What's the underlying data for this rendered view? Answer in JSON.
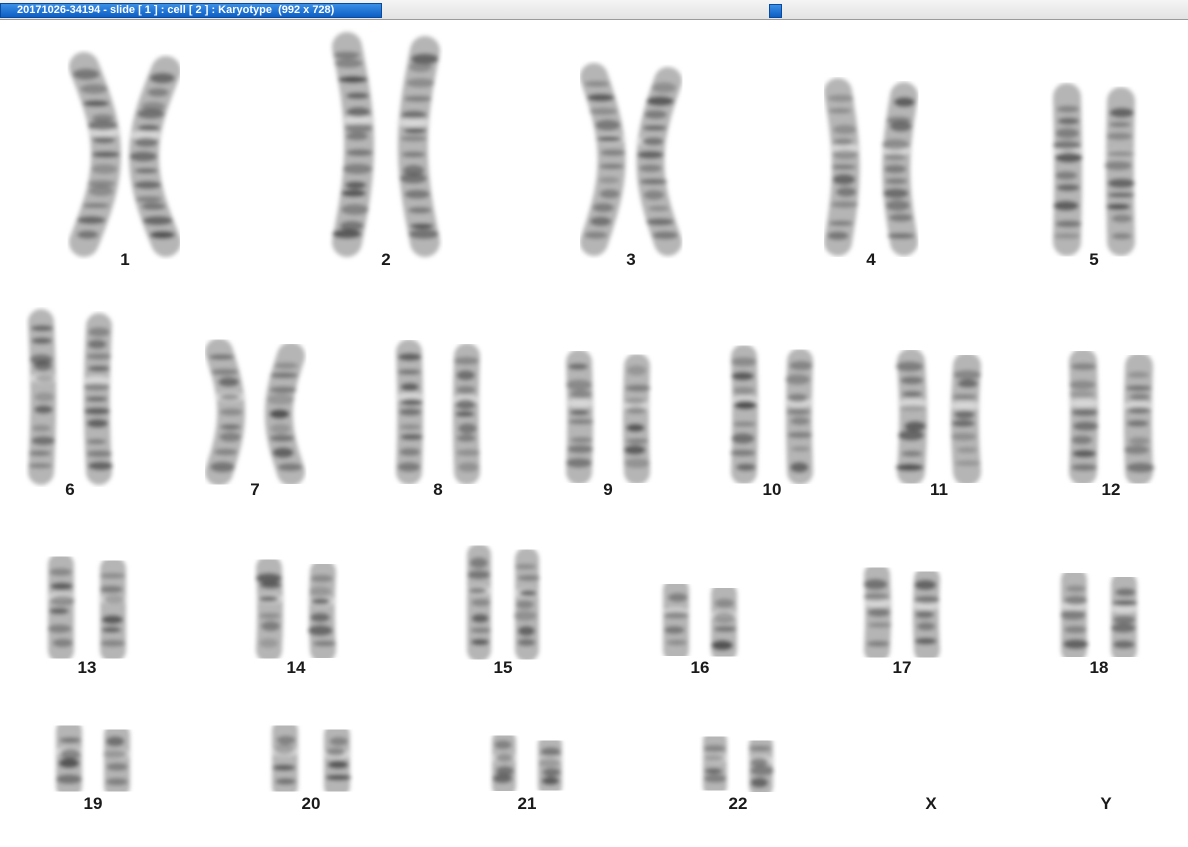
{
  "window": {
    "title": "20171026-34194 - slide [ 1 ] : cell [ 2 ] : Karyotype  (992 x 728)"
  },
  "karyotype": {
    "chromosomes": [
      {
        "label": "1"
      },
      {
        "label": "2"
      },
      {
        "label": "3"
      },
      {
        "label": "4"
      },
      {
        "label": "5"
      },
      {
        "label": "6"
      },
      {
        "label": "7"
      },
      {
        "label": "8"
      },
      {
        "label": "9"
      },
      {
        "label": "10"
      },
      {
        "label": "11"
      },
      {
        "label": "12"
      },
      {
        "label": "13"
      },
      {
        "label": "14"
      },
      {
        "label": "15"
      },
      {
        "label": "16"
      },
      {
        "label": "17"
      },
      {
        "label": "18"
      },
      {
        "label": "19"
      },
      {
        "label": "20"
      },
      {
        "label": "21"
      },
      {
        "label": "22"
      },
      {
        "label": "X"
      },
      {
        "label": "Y"
      }
    ]
  }
}
